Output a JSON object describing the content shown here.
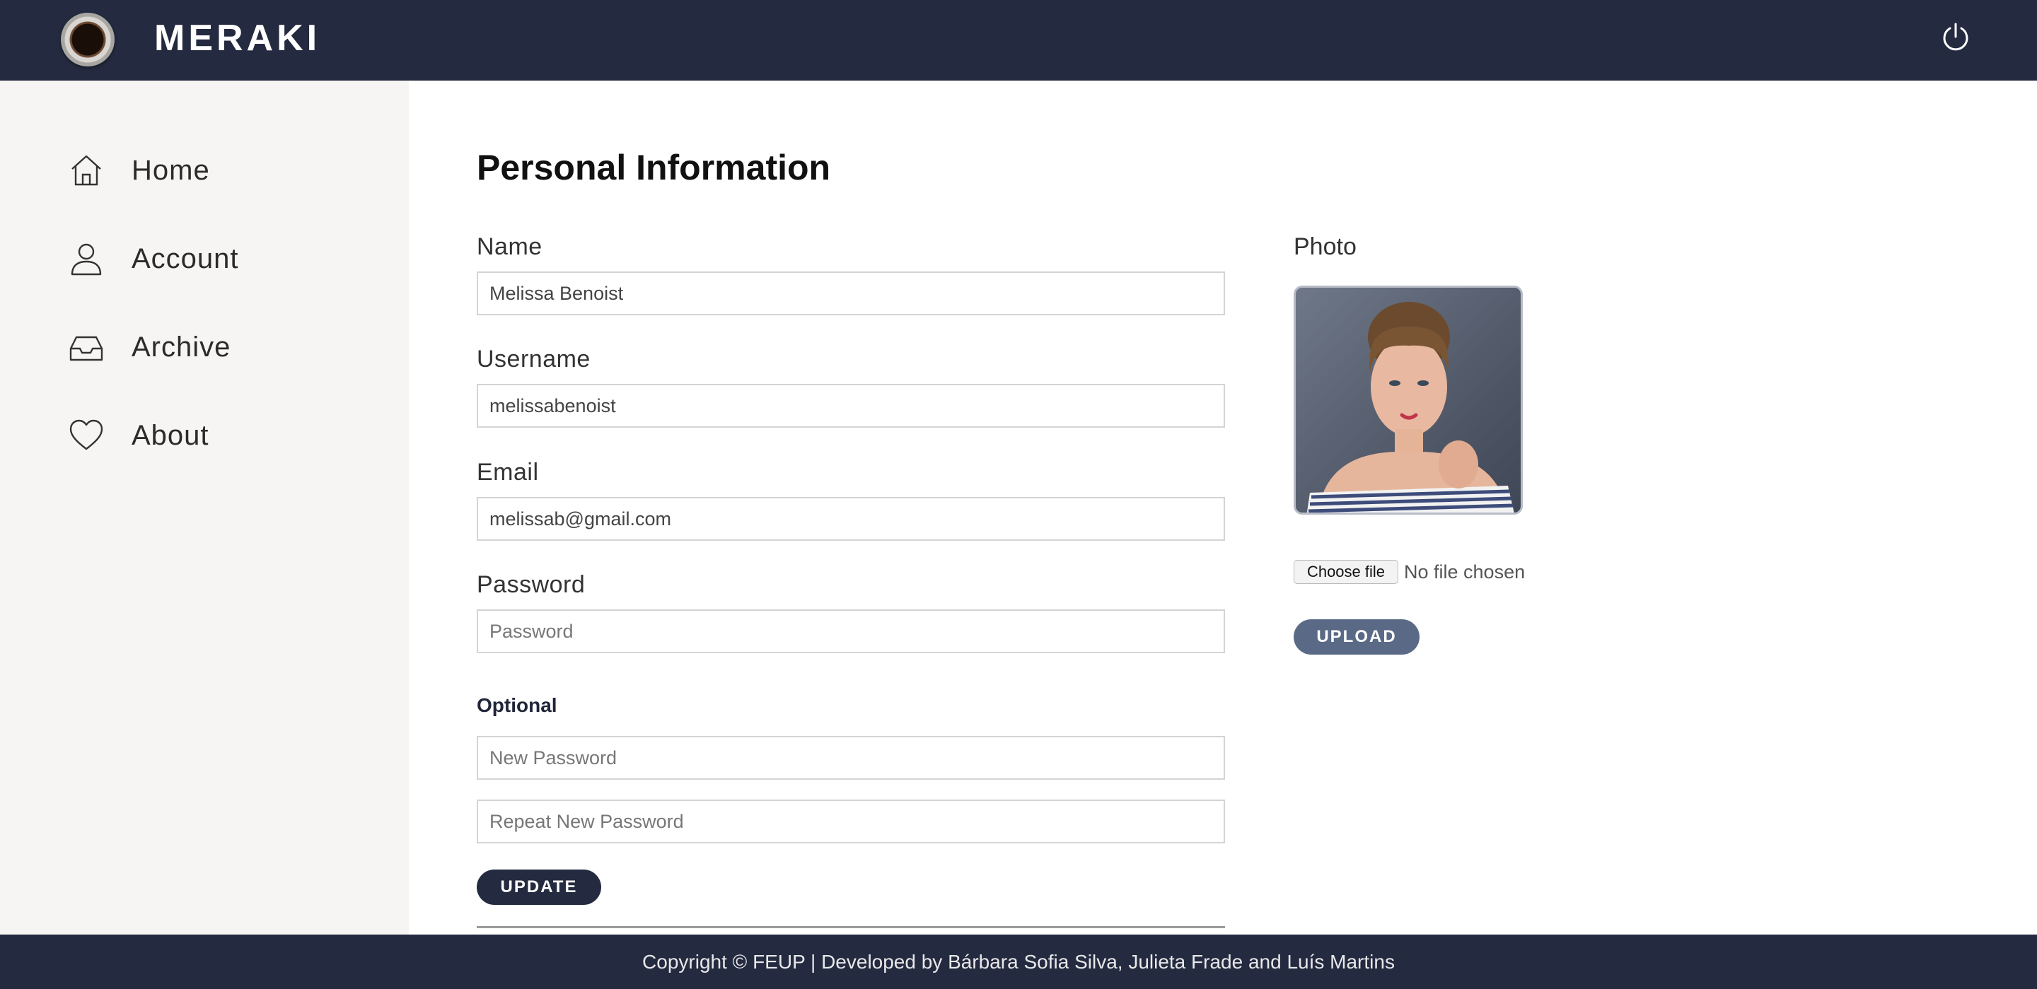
{
  "header": {
    "brand": "MERAKI",
    "logo_icon": "coffee-cup-icon",
    "power_icon": "power-icon"
  },
  "sidebar": {
    "items": [
      {
        "label": "Home",
        "icon": "home-icon"
      },
      {
        "label": "Account",
        "icon": "user-icon"
      },
      {
        "label": "Archive",
        "icon": "inbox-icon"
      },
      {
        "label": "About",
        "icon": "heart-icon"
      }
    ]
  },
  "form": {
    "title": "Personal Information",
    "name_label": "Name",
    "name_value": "Melissa Benoist",
    "username_label": "Username",
    "username_value": "melissabenoist",
    "email_label": "Email",
    "email_value": "melissab@gmail.com",
    "password_label": "Password",
    "password_placeholder": "Password",
    "optional_label": "Optional",
    "new_password_placeholder": "New Password",
    "repeat_password_placeholder": "Repeat New Password",
    "update_button": "UPDATE"
  },
  "photo": {
    "label": "Photo",
    "choose_file_button": "Choose file",
    "file_status": "No file chosen",
    "upload_button": "UPLOAD"
  },
  "footer": {
    "text": "Copyright © FEUP | Developed by Bárbara Sofia Silva, Julieta Frade and Luís Martins"
  },
  "colors": {
    "header_bg": "#242a3f",
    "sidebar_bg": "#f6f5f3",
    "upload_button_bg": "#5a6a86"
  }
}
